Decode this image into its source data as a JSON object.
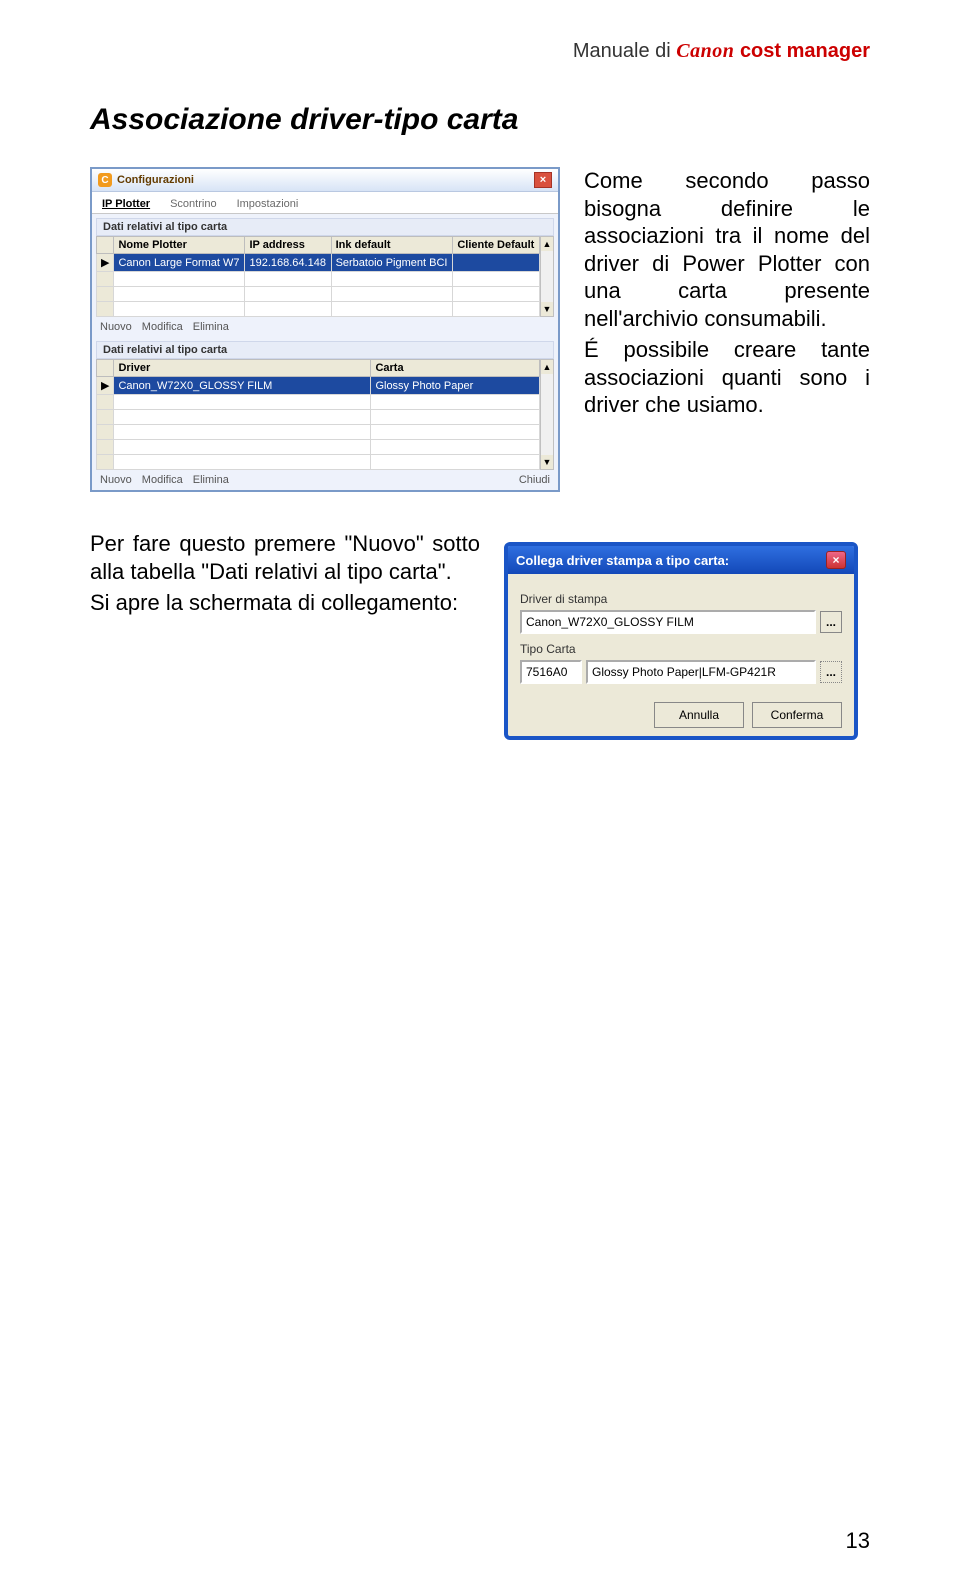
{
  "header": {
    "prefix": "Manuale di ",
    "brand": "Canon",
    "product": " cost manager"
  },
  "section_title": "Associazione driver-tipo carta",
  "paragraph1": "Come secondo passo bisogna definire le associazioni tra il nome del driver di Power Plotter con una carta presente nell'archivio consumabili.",
  "paragraph1b": "É possibile creare tante associazioni quanti sono i driver che usiamo.",
  "paragraph2": "Per fare questo premere \"Nuovo\" sotto alla tabella \"Dati relativi al tipo carta\".",
  "paragraph2b": "Si apre la schermata di collegamento:",
  "win_config": {
    "title": "Configurazioni",
    "tabs": [
      "IP Plotter",
      "Scontrino",
      "Impostazioni"
    ],
    "section1_label": "Dati relativi al tipo carta",
    "grid1": {
      "headers": [
        "Nome Plotter",
        "IP address",
        "Ink default",
        "Cliente Default"
      ],
      "row": [
        "Canon Large Format W7",
        "192.168.64.148",
        "Serbatoio Pigment BCI",
        ""
      ]
    },
    "buttons": {
      "nuovo": "Nuovo",
      "modifica": "Modifica",
      "elimina": "Elimina",
      "chiudi": "Chiudi"
    },
    "section2_label": "Dati relativi al tipo carta",
    "grid2": {
      "headers": [
        "Driver",
        "Carta"
      ],
      "row": [
        "Canon_W72X0_GLOSSY FILM",
        "Glossy Photo Paper"
      ]
    }
  },
  "dlg_link": {
    "title": "Collega driver stampa a tipo carta:",
    "label_driver": "Driver di stampa",
    "value_driver": "Canon_W72X0_GLOSSY FILM",
    "label_carta": "Tipo Carta",
    "value_code": "7516A0",
    "value_carta": "Glossy Photo Paper|LFM-GP421R",
    "btn_cancel": "Annulla",
    "btn_ok": "Conferma"
  },
  "page_number": "13"
}
